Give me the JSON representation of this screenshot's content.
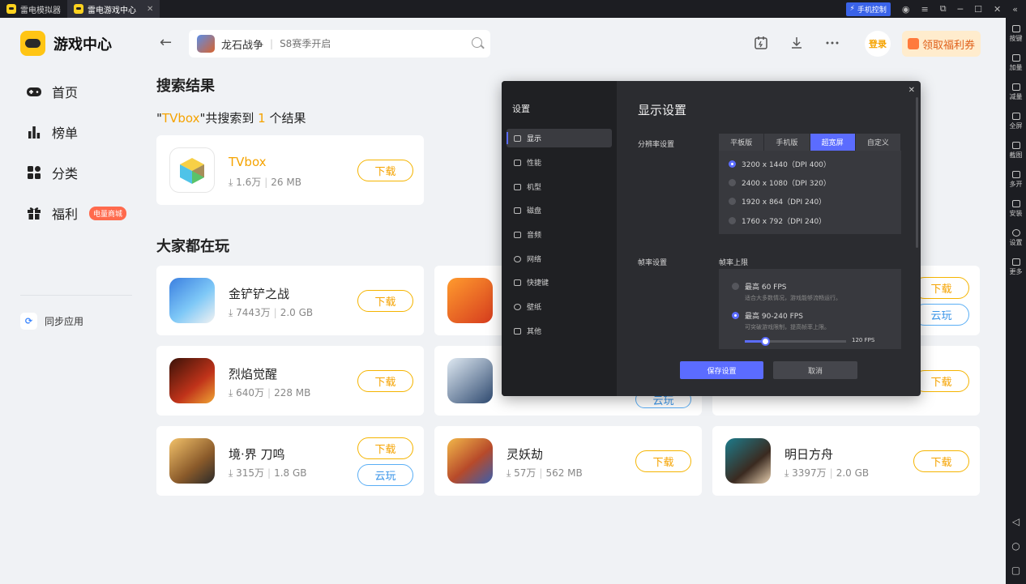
{
  "titlebar": {
    "tabs": [
      {
        "label": "雷电模拟器"
      },
      {
        "label": "雷电游戏中心"
      }
    ],
    "phone_control": "手机控制"
  },
  "sidebar": {
    "brand": "游戏中心",
    "nav": [
      {
        "label": "首页",
        "icon": "gamepad-icon"
      },
      {
        "label": "榜单",
        "icon": "bar-chart-icon"
      },
      {
        "label": "分类",
        "icon": "grid-icon"
      },
      {
        "label": "福利",
        "icon": "gift-icon",
        "badge": "电量商城"
      }
    ],
    "sync": "同步应用"
  },
  "header": {
    "search_game": "龙石战争",
    "search_placeholder": "S8赛季开启",
    "login": "登录",
    "voucher": "领取福利券"
  },
  "search_results": {
    "title": "搜索结果",
    "query_prefix": "\"",
    "query": "TVbox",
    "query_mid": "\"共搜索到 ",
    "count": "1",
    "query_suffix": " 个结果",
    "item": {
      "name": "TVbox",
      "downloads": "1.6万",
      "size": "26 MB",
      "button": "下载"
    }
  },
  "popular": {
    "title": "大家都在玩",
    "download_label": "下载",
    "cloud_label": "云玩",
    "games": [
      {
        "name": "金铲铲之战",
        "downloads": "7443万",
        "size": "2.0 GB"
      },
      {
        "name": "烈焰觉醒",
        "downloads": "640万",
        "size": "228 MB"
      },
      {
        "name": "境·界 刀鸣",
        "downloads": "315万",
        "size": "1.8 GB"
      },
      {
        "name": "灵妖劫",
        "downloads": "57万",
        "size": "562 MB"
      },
      {
        "name": "明日方舟",
        "downloads": "3397万",
        "size": "2.0 GB"
      }
    ]
  },
  "settings": {
    "title": "设置",
    "menu": [
      "显示",
      "性能",
      "机型",
      "磁盘",
      "音频",
      "网络",
      "快捷键",
      "壁纸",
      "其他"
    ],
    "heading": "显示设置",
    "resolution_label": "分辨率设置",
    "tabs": [
      "平板版",
      "手机版",
      "超宽屏",
      "自定义"
    ],
    "resolutions": [
      "3200 x 1440（DPI 400）",
      "2400 x 1080（DPI 320）",
      "1920 x 864（DPI 240）",
      "1760 x 792（DPI 240）"
    ],
    "fps_label": "帧率设置",
    "fps_limit_label": "帧率上限",
    "fps_options": [
      {
        "label": "最高 60 FPS",
        "desc": "适合大多数情况，游戏能够流畅运行。"
      },
      {
        "label": "最高 90-240 FPS",
        "desc": "可突破游戏限制，提高帧率上限。"
      }
    ],
    "fps_value": "120 FPS",
    "fps_slider_fraction": 0.2,
    "save": "保存设置",
    "cancel": "取消"
  },
  "rightbar": {
    "items": [
      "按键",
      "加量",
      "减量",
      "全屏",
      "截图",
      "多开",
      "安装",
      "设置",
      "更多"
    ]
  },
  "colors": {
    "accent": "#f5a300",
    "modal_accent": "#5b6cff"
  }
}
